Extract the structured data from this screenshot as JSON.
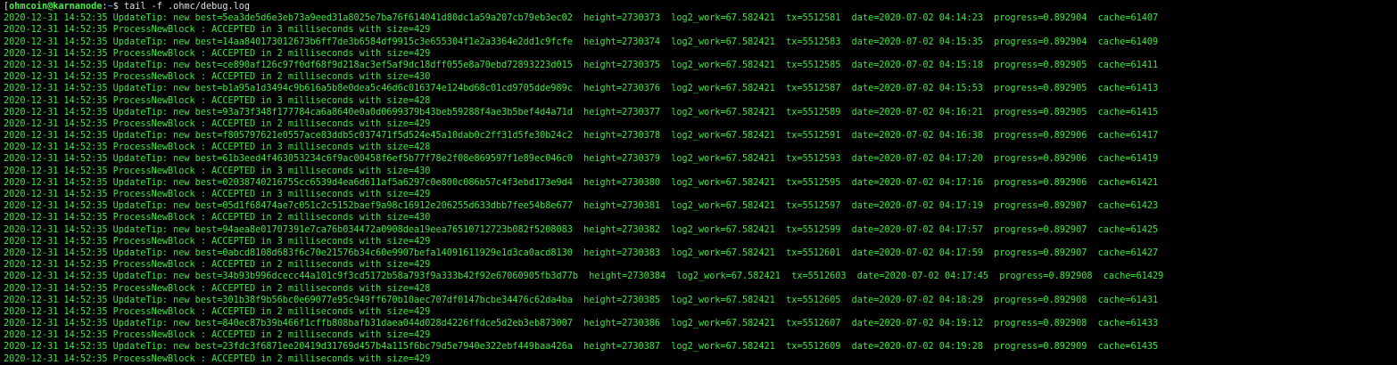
{
  "prompt": {
    "bracket": "[",
    "user_host": "ohmcoin@karnanode",
    "path_sep": ":",
    "path": "~",
    "symbol": "$",
    "command": "tail -f .ohmc/debug.log"
  },
  "colors": {
    "background": "#000000",
    "text": "#3be83b",
    "prompt_user": "#4af04a",
    "prompt_path": "#4a7cf0",
    "command": "#e0e0e0"
  },
  "log_lines": [
    "2020-12-31 14:52:35 UpdateTip: new best=5ea3de5d6e3eb73a9eed31a8025e7ba76f614041d80dc1a59a207cb79eb3ec02  height=2730373  log2_work=67.582421  tx=5512581  date=2020-07-02 04:14:23  progress=0.892904  cache=61407",
    "2020-12-31 14:52:35 ProcessNewBlock : ACCEPTED in 3 milliseconds with size=429",
    "2020-12-31 14:52:35 UpdateTip: new best=14aa840173012673b6ff7de3b6584df9915c3e655304f1e2a3364e2dd1c9fcfe  height=2730374  log2_work=67.582421  tx=5512583  date=2020-07-02 04:15:35  progress=0.892904  cache=61409",
    "2020-12-31 14:52:35 ProcessNewBlock : ACCEPTED in 2 milliseconds with size=429",
    "2020-12-31 14:52:35 UpdateTip: new best=ce890af126c97f0df68f9d218ac3ef5af9dc18dff055e8a70ebd72893223d015  height=2730375  log2_work=67.582421  tx=5512585  date=2020-07-02 04:15:18  progress=0.892905  cache=61411",
    "2020-12-31 14:52:35 ProcessNewBlock : ACCEPTED in 2 milliseconds with size=430",
    "2020-12-31 14:52:35 UpdateTip: new best=b1a95a1d3494c9b616a5b8e0dea5c46d6c016374e124bd68c01cd9705dde989c  height=2730376  log2_work=67.582421  tx=5512587  date=2020-07-02 04:15:53  progress=0.892905  cache=61413",
    "2020-12-31 14:52:35 ProcessNewBlock : ACCEPTED in 3 milliseconds with size=428",
    "2020-12-31 14:52:35 UpdateTip: new best=93a73f348f177784ca6a8640e0a0d0699379b43beb59288f4ae3b5bef4d4a71d  height=2730377  log2_work=67.582421  tx=5512589  date=2020-07-02 04:16:21  progress=0.892905  cache=61415",
    "2020-12-31 14:52:35 ProcessNewBlock : ACCEPTED in 2 milliseconds with size=429",
    "2020-12-31 14:52:35 UpdateTip: new best=f805797621e0557ace83ddb5c037471f5d524e45a10dab0c2ff31d5fe30b24c2  height=2730378  log2_work=67.582421  tx=5512591  date=2020-07-02 04:16:38  progress=0.892906  cache=61417",
    "2020-12-31 14:52:35 ProcessNewBlock : ACCEPTED in 3 milliseconds with size=428",
    "2020-12-31 14:52:35 UpdateTip: new best=61b3eed4f463053234c6f9ac00458f6ef5b77f78e2f08e869597f1e89ec046c0  height=2730379  log2_work=67.582421  tx=5512593  date=2020-07-02 04:17:20  progress=0.892906  cache=61419",
    "2020-12-31 14:52:35 ProcessNewBlock : ACCEPTED in 3 milliseconds with size=430",
    "2020-12-31 14:52:35 UpdateTip: new best=0203874021675Scc6539d4ea6d611af5a6297c0e800c086b57c4f3ebd173e9d4  height=2730380  log2_work=67.582421  tx=5512595  date=2020-07-02 04:17:16  progress=0.892906  cache=61421",
    "2020-12-31 14:52:35 ProcessNewBlock : ACCEPTED in 3 milliseconds with size=429",
    "2020-12-31 14:52:35 UpdateTip: new best=05d1f68474ae7c051c2c5152baef9a98c16912e206255d633dbb7fee54b8e677  height=2730381  log2_work=67.582421  tx=5512597  date=2020-07-02 04:17:19  progress=0.892907  cache=61423",
    "2020-12-31 14:52:35 ProcessNewBlock : ACCEPTED in 2 milliseconds with size=430",
    "2020-12-31 14:52:35 UpdateTip: new best=94aea8e01707391e7ca76b034472a0908dea19eea76510712723b082f5208083  height=2730382  log2_work=67.582421  tx=5512599  date=2020-07-02 04:17:57  progress=0.892907  cache=61425",
    "2020-12-31 14:52:35 ProcessNewBlock : ACCEPTED in 3 milliseconds with size=429",
    "2020-12-31 14:52:35 UpdateTip: new best=0abcd8108d683f6c70e21576b34c60e9907befa14091611929e1d3ca0acd8130  height=2730383  log2_work=67.582421  tx=5512601  date=2020-07-02 04:17:59  progress=0.892907  cache=61427",
    "2020-12-31 14:52:35 ProcessNewBlock : ACCEPTED in 2 milliseconds with size=429",
    "2020-12-31 14:52:35 UpdateTip: new best=34b93b996dcecc44a101c9f3cd5172b58a793f9a333b42f92e67060905fb3d77b  height=2730384  log2_work=67.582421  tx=5512603  date=2020-07-02 04:17:45  progress=0.892908  cache=61429",
    "2020-12-31 14:52:35 ProcessNewBlock : ACCEPTED in 2 milliseconds with size=428",
    "2020-12-31 14:52:35 UpdateTip: new best=301b38f9b56bc0e69077e95c949ff670b10aec707df0147bcbe34476c62da4ba  height=2730385  log2_work=67.582421  tx=5512605  date=2020-07-02 04:18:29  progress=0.892908  cache=61431",
    "2020-12-31 14:52:35 ProcessNewBlock : ACCEPTED in 2 milliseconds with size=429",
    "2020-12-31 14:52:35 UpdateTip: new best=840ec87b39b466f1cffb808bafb31daea044d028d4226ffdce5d2eb3eb873007  height=2730386  log2_work=67.582421  tx=5512607  date=2020-07-02 04:19:12  progress=0.892908  cache=61433",
    "2020-12-31 14:52:35 ProcessNewBlock : ACCEPTED in 2 milliseconds with size=429",
    "2020-12-31 14:52:35 UpdateTip: new best=23fdc3f6871ee20419d31769d457b4a115f6bc79d5e7940e322ebf449baa426a  height=2730387  log2_work=67.582421  tx=5512609  date=2020-07-02 04:19:28  progress=0.892909  cache=61435",
    "2020-12-31 14:52:35 ProcessNewBlock : ACCEPTED in 2 milliseconds with size=429"
  ]
}
